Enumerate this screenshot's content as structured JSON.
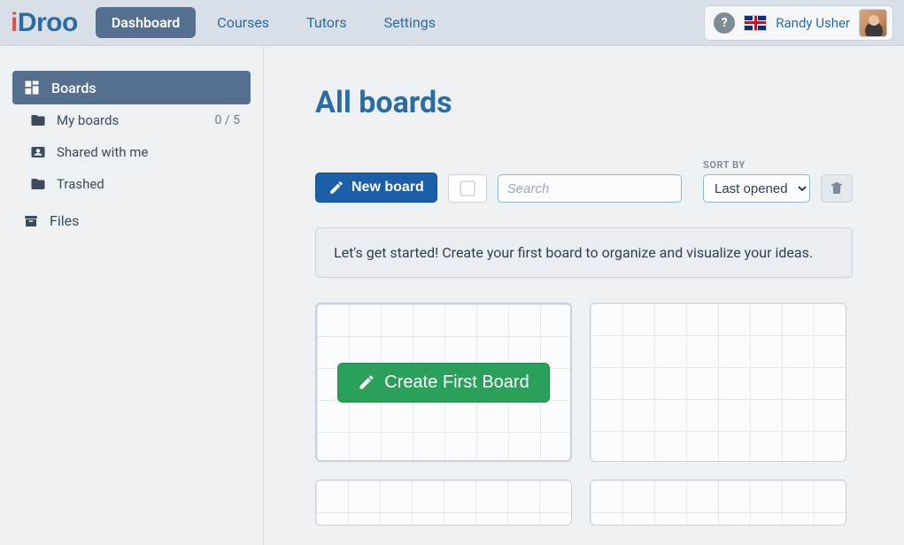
{
  "logo": {
    "i": "i",
    "rest": "Droo"
  },
  "nav": {
    "dashboard": "Dashboard",
    "courses": "Courses",
    "tutors": "Tutors",
    "settings": "Settings"
  },
  "user": {
    "name": "Randy Usher"
  },
  "sidebar": {
    "boards": "Boards",
    "my_boards": "My boards",
    "my_boards_meta": "0 / 5",
    "shared": "Shared with me",
    "trashed": "Trashed",
    "files": "Files"
  },
  "page": {
    "title": "All boards",
    "new_board": "New board",
    "search_placeholder": "Search",
    "sort_label": "SORT BY",
    "sort_value": "Last opened",
    "banner": "Let's get started! Create your first board to organize and visualize your ideas.",
    "create_first": "Create First Board"
  }
}
